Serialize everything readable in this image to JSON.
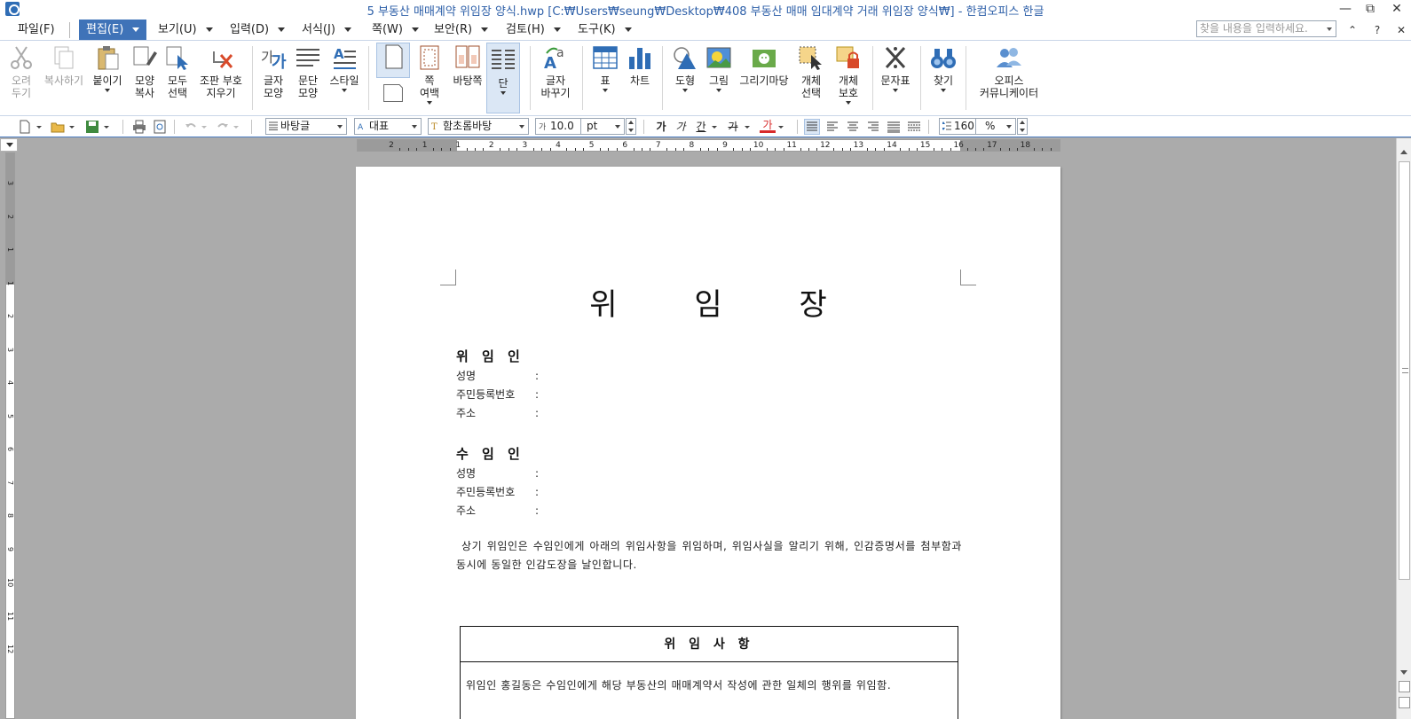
{
  "window": {
    "title": "5 부동산 매매계약 위임장 양식.hwp [C:₩Users₩seung₩Desktop₩408 부동산 매매 임대계약 거래 위임장 양식₩] - 한컴오피스 한글"
  },
  "menu": {
    "items": [
      "파일(F)",
      "편집(E)",
      "보기(U)",
      "입력(D)",
      "서식(J)",
      "쪽(W)",
      "보안(R)",
      "검토(H)",
      "도구(K)"
    ],
    "search_placeholder": "찾을 내용을 입력하세요."
  },
  "ribbon": {
    "cut": "오려\n두기",
    "copy": "복사하기",
    "paste": "붙이기",
    "format_copy": "모양\n복사",
    "select_all": "모두\n선택",
    "clear_codes": "조판 부호\n지우기",
    "char_shape": "글자\n모양",
    "para_shape": "문단\n모양",
    "style": "스타일",
    "page_margin": "쪽\n여백",
    "master_page": "바탕쪽",
    "column": "단",
    "replace_char": "글자\n바꾸기",
    "table": "표",
    "chart": "차트",
    "shape": "도형",
    "picture": "그림",
    "drawing_gallery": "그리기마당",
    "select_object": "개체\n선택",
    "protect_object": "개체\n보호",
    "symbols": "문자표",
    "find": "찾기",
    "office_communicator": "오피스\n커뮤니케이터"
  },
  "format_bar": {
    "style": "바탕글",
    "language": "대표",
    "font": "함초롬바탕",
    "font_size": "10.0",
    "size_unit": "pt",
    "bold": "가",
    "italic": "가",
    "underline": "간",
    "strike": "가",
    "font_color": "가",
    "line_spacing": "160",
    "line_spacing_unit": "%"
  },
  "ruler": {
    "h_numbers": [
      "2",
      "1",
      "1",
      "2",
      "3",
      "4",
      "5",
      "6",
      "7",
      "8",
      "9",
      "10",
      "11",
      "12",
      "13",
      "14",
      "15",
      "16",
      "17",
      "18"
    ],
    "v_numbers": [
      "3",
      "2",
      "1",
      "1",
      "2",
      "3",
      "4",
      "5",
      "6",
      "7",
      "8",
      "9",
      "10",
      "11",
      "12"
    ]
  },
  "document": {
    "title": "위 임 장",
    "delegator": {
      "heading": "위 임 인",
      "fields": [
        "성명",
        "주민등록번호",
        "주소"
      ]
    },
    "delegate": {
      "heading": "수 임 인",
      "fields": [
        "성명",
        "주민등록번호",
        "주소"
      ]
    },
    "paragraph": "상기 위임인은 수임인에게 아래의 위임사항을 위임하며, 위임사실을 알리기 위해, 인감증명서를 첨부함과 동시에 동일한 인감도장을 날인합니다.",
    "box": {
      "heading": "위 임 사 항",
      "body": "위임인 홍길동은 수임인에게 해당 부동산의 매매계약서 작성에 관한 일체의 행위를 위임함."
    }
  }
}
